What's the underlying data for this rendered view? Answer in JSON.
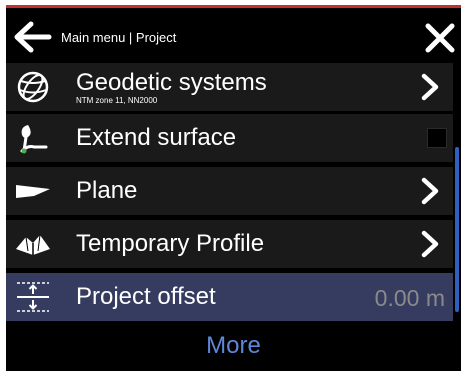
{
  "header": {
    "title": "Main menu | Project",
    "back_icon": "arrow-left-icon",
    "close_icon": "close-icon"
  },
  "menu": {
    "items": [
      {
        "label": "Geodetic systems",
        "sublabel": "NTM zone 11, NN2000",
        "icon": "globe-icon",
        "trailing": "chevron-right-icon"
      },
      {
        "label": "Extend surface",
        "icon": "extend-surface-icon",
        "trailing": "checkbox",
        "checked": false
      },
      {
        "label": "Plane",
        "icon": "plane-icon",
        "trailing": "chevron-right-icon"
      },
      {
        "label": "Temporary Profile",
        "icon": "temporary-profile-icon",
        "trailing": "chevron-right-icon"
      },
      {
        "label": "Project offset",
        "value": "0.00 m",
        "icon": "offset-icon",
        "selected": true
      }
    ],
    "more_label": "More"
  },
  "colors": {
    "background": "#000000",
    "row": "#1a1a1a",
    "selected_row": "#353c60",
    "accent": "#5f86d8",
    "scrollbar": "#2f5fbf",
    "top_stripe": "#c43030"
  }
}
